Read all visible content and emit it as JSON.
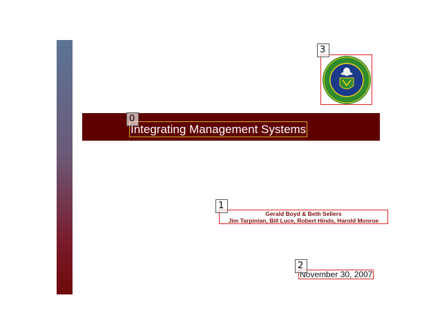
{
  "slide": {
    "title": "Integrating Management Systems",
    "authors_line1": "Gerald Boyd & Beth Sellers",
    "authors_line2": "Jim Tarpinian, Bill Luce, Robert Hinds, Harold Monroe",
    "date": "November 30, 2007",
    "logo": {
      "icon": "doe-seal-icon",
      "text_top": "DEPARTMENT OF ENERGY",
      "text_bottom": "UNITED STATES OF AMERICA"
    }
  },
  "markers": {
    "m0": "0",
    "m1": "1",
    "m2": "2",
    "m3": "3"
  },
  "colors": {
    "title_band": "#5e0000",
    "author_text": "#7a0f0f",
    "box_outline": "#e02020",
    "title_outline": "#d8b020"
  }
}
